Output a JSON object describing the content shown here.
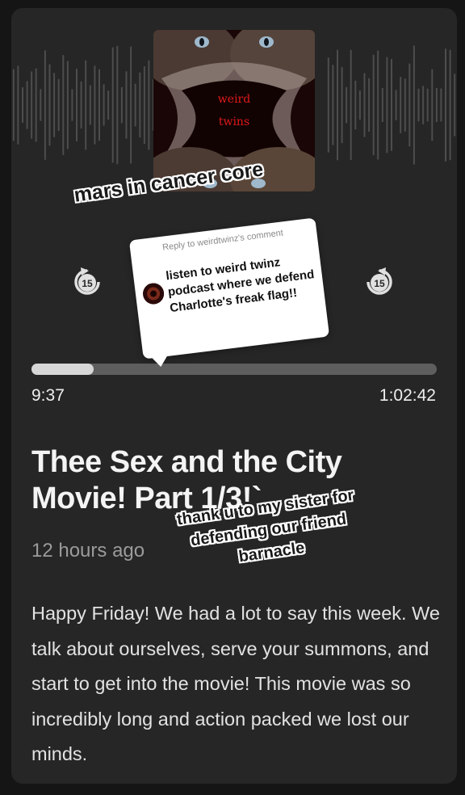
{
  "colors": {
    "background": "#151515",
    "card": "#262626",
    "progress_fill": "#d7d7d7",
    "progress_track": "#5e5e5e",
    "cover_text": "#e01818"
  },
  "cover": {
    "line1": "weird",
    "line2": "twins"
  },
  "overlay": {
    "caption_top": "mars in cancer core",
    "caption_bottom_lines": [
      "thank u to my sister for",
      "defending our friend",
      "barnacle"
    ]
  },
  "reply": {
    "header": "Reply to weirdtwinz's comment",
    "body": "listen to weird twinz podcast where we defend Charlotte's freak flag!!"
  },
  "player": {
    "skip_back_seconds": "15",
    "skip_forward_seconds": "15",
    "progress_fraction": 0.154,
    "elapsed": "9:37",
    "total": "1:02:42"
  },
  "episode": {
    "title": "Thee Sex and the City Movie! Part 1/3!`",
    "published": "12 hours ago",
    "description": "Happy Friday! We had a lot to say this week. We talk about ourselves, serve your summons, and start to get into the movie! This movie was so incredibly long and action packed we lost our minds."
  },
  "icons": {
    "skip_back": "rewind-15-icon",
    "skip_forward": "forward-15-icon",
    "avatar": "avatar"
  }
}
